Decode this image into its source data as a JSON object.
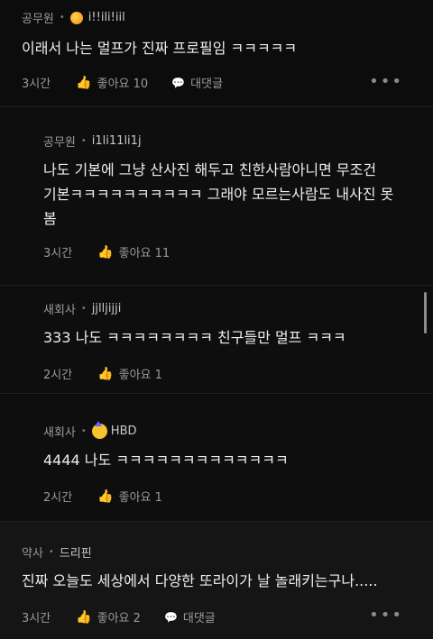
{
  "comments": [
    {
      "author": "공무원",
      "nickname": "i!!ili!iil",
      "text": "이래서 나는 멀프가 진짜 프로필임 ㅋㅋㅋㅋㅋ",
      "time": "3시간",
      "like_label": "좋아요 10",
      "reply_label": "대댓글"
    },
    {
      "author": "공무원",
      "nickname": "i1li11li1j",
      "text_line1": "나도 기본에 그냥 산사진 해두고 친한사람아니면 무조건",
      "text_line2": "기본ㅋㅋㅋㅋㅋㅋㅋㅋㅋㅋ 그래야 모르는사람도 내사진 못",
      "text_line3": "봄",
      "time": "3시간",
      "like_label": "좋아요 11"
    },
    {
      "author": "새회사",
      "nickname": "jjlljijji",
      "text": "333 나도 ㅋㅋㅋㅋㅋㅋㅋㅋ 친구들만 멀프 ㅋㅋㅋ",
      "time": "2시간",
      "like_label": "좋아요 1"
    },
    {
      "author": "새회사",
      "nickname": "HBD",
      "text": "4444 나도 ㅋㅋㅋㅋㅋㅋㅋㅋㅋㅋㅋㅋㅋ",
      "time": "2시간",
      "like_label": "좋아요 1"
    },
    {
      "author": "약사",
      "nickname": "드리핀",
      "text": "진짜 오늘도 세상에서 다양한 또라이가 날 놀래키는구나.....",
      "time": "3시간",
      "like_label": "좋아요 2",
      "reply_label": "대댓글"
    }
  ],
  "icons": {
    "like": "thumbs-up-icon",
    "reply": "speech-bubble-icon",
    "more": "more-dots-icon"
  },
  "colors": {
    "background": "#0c0c0c",
    "text": "#ededed",
    "muted": "#9a9a9a"
  }
}
